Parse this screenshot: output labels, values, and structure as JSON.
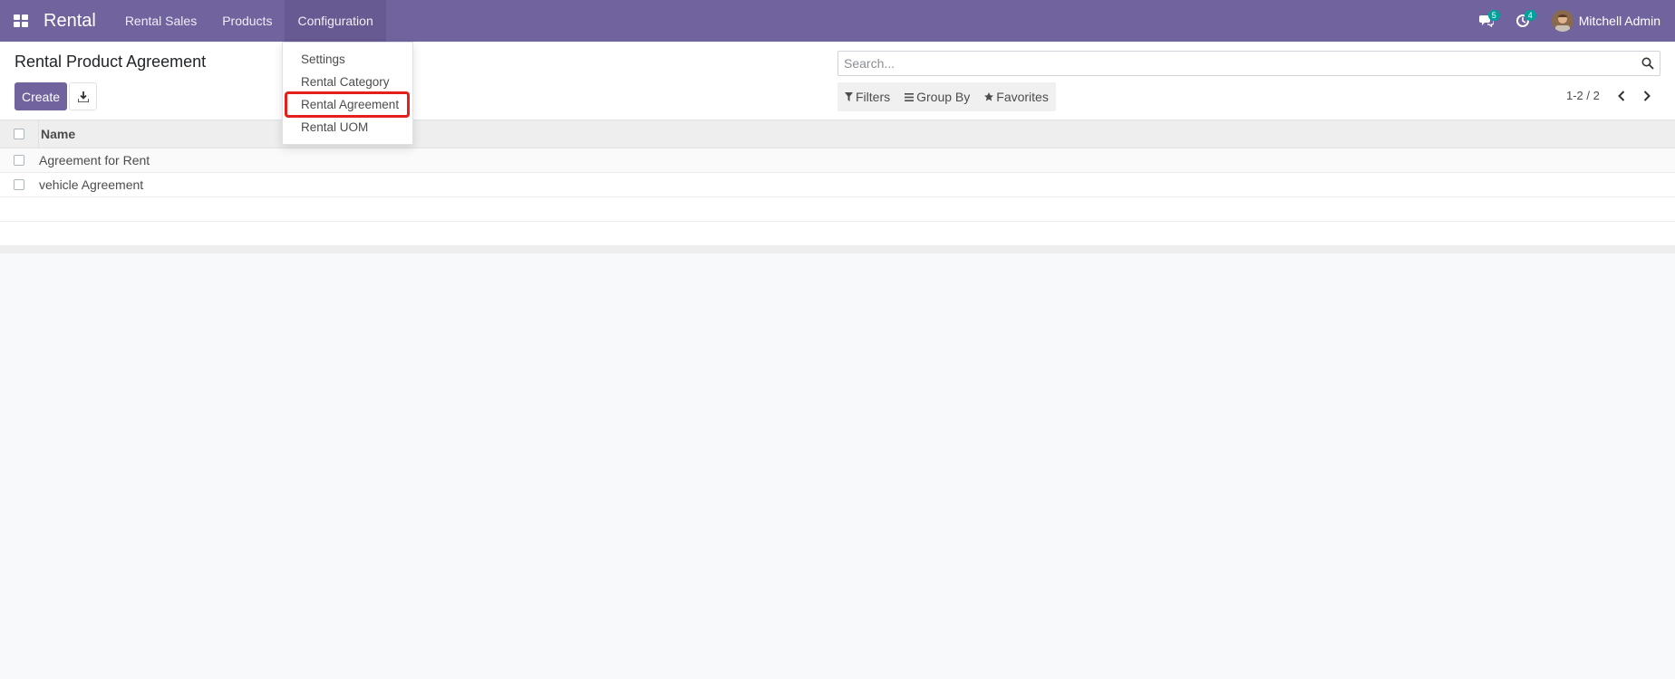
{
  "navbar": {
    "brand": "Rental",
    "menu": [
      {
        "label": "Rental Sales"
      },
      {
        "label": "Products"
      },
      {
        "label": "Configuration"
      }
    ],
    "messages_badge": "5",
    "activities_badge": "4",
    "user_name": "Mitchell Admin",
    "accent_color": "#71639e"
  },
  "control_panel": {
    "title": "Rental Product Agreement",
    "create_label": "Create",
    "search_placeholder": "Search...",
    "filters_label": "Filters",
    "group_by_label": "Group By",
    "favorites_label": "Favorites",
    "pager": "1-2 / 2"
  },
  "list": {
    "column_name": "Name",
    "rows": [
      {
        "name": "Agreement for Rent"
      },
      {
        "name": "vehicle Agreement"
      }
    ]
  },
  "dropdown": {
    "items": [
      {
        "label": "Settings"
      },
      {
        "label": "Rental Category"
      },
      {
        "label": "Rental Agreement"
      },
      {
        "label": "Rental UOM"
      }
    ],
    "highlight_color": "#e3201b"
  },
  "icons": {
    "apps": "apps-grid-icon",
    "messages": "chat-icon",
    "activities": "clock-icon",
    "search": "search-icon",
    "export": "download-icon",
    "filter": "filter-icon",
    "group": "list-icon",
    "favorite": "star-icon",
    "prev": "chevron-left-icon",
    "next": "chevron-right-icon"
  }
}
